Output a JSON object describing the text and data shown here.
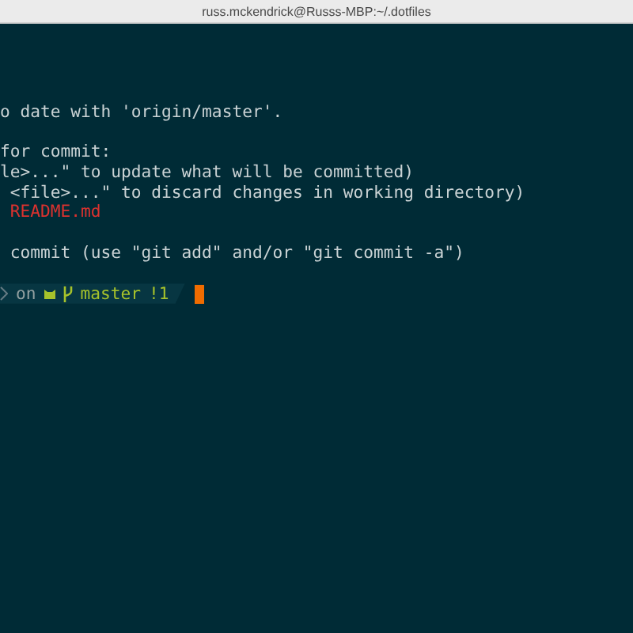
{
  "window": {
    "title": "russ.mckendrick@Russs-MBP:~/.dotfiles"
  },
  "output_blocks": [
    {
      "lines": [
        {
          "text": "o date with 'origin/master'.",
          "kind": "plain"
        }
      ]
    },
    {
      "lines": [
        {
          "text": "for commit:",
          "kind": "plain"
        },
        {
          "text": "le>...\" to update what will be committed)",
          "kind": "plain"
        },
        {
          "text": " <file>...\" to discard changes in working directory)",
          "kind": "plain"
        },
        {
          "text": " README.md",
          "kind": "modified"
        }
      ]
    },
    {
      "lines": [
        {
          "text": " commit (use \"git add\" and/or \"git commit -a\")",
          "kind": "plain"
        }
      ]
    }
  ],
  "prompt": {
    "on": "on",
    "branch": "master",
    "status": "!1"
  }
}
